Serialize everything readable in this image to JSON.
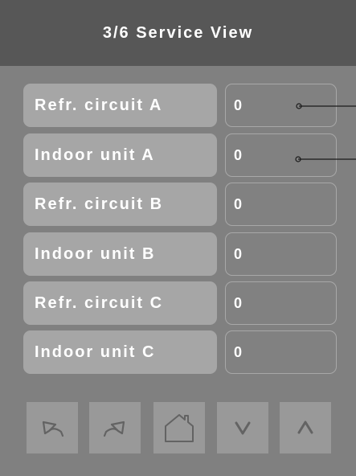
{
  "header": {
    "title": "3/6 Service View"
  },
  "rows": [
    {
      "label": "Refr. circuit A",
      "value": "0"
    },
    {
      "label": "Indoor unit A",
      "value": "0"
    },
    {
      "label": "Refr. circuit B",
      "value": "0"
    },
    {
      "label": "Indoor unit B",
      "value": "0"
    },
    {
      "label": "Refr. circuit C",
      "value": "0"
    },
    {
      "label": "Indoor unit C",
      "value": "0"
    }
  ],
  "nav": [
    {
      "icon": "undo-icon"
    },
    {
      "icon": "redo-icon"
    },
    {
      "icon": "home-icon"
    },
    {
      "icon": "chevron-down-icon"
    },
    {
      "icon": "chevron-up-icon"
    }
  ],
  "colors": {
    "background": "#808080",
    "header": "#575757",
    "label_button": "#a6a6a6",
    "value_border": "#a8a8a8",
    "nav_button": "#999999",
    "icon": "#636363",
    "text": "#ffffff"
  }
}
